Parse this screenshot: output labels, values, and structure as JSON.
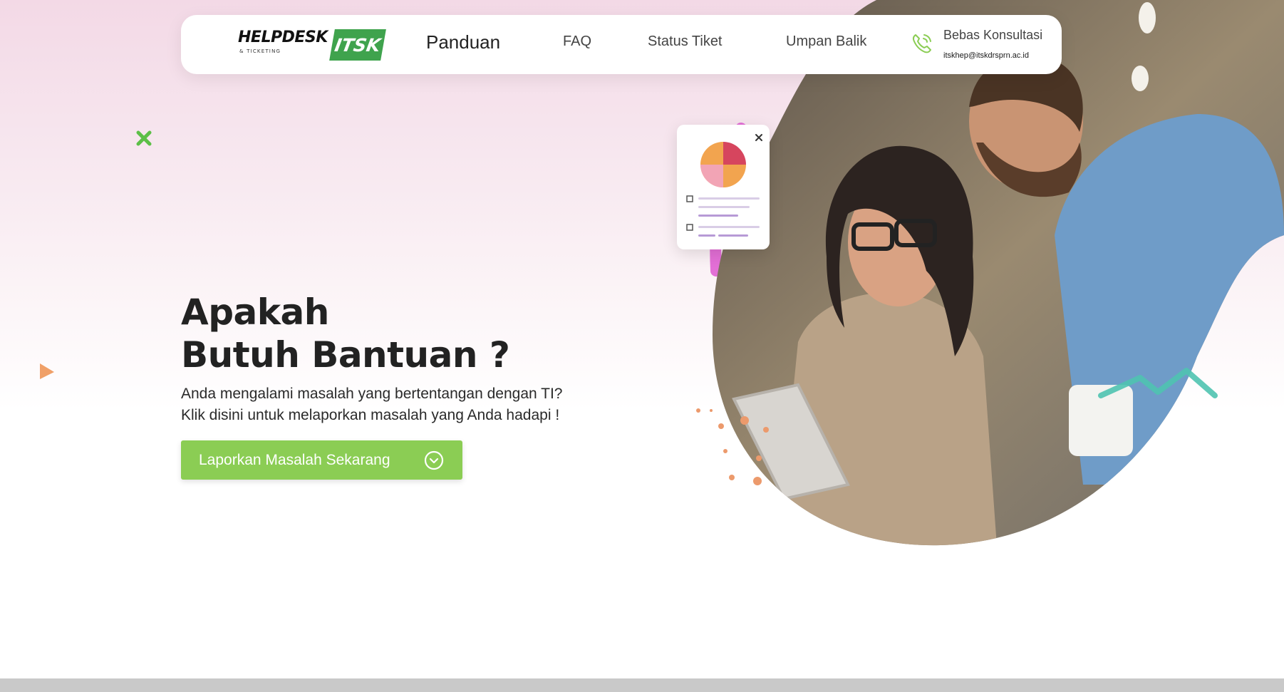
{
  "nav": {
    "logo_main": "HELPDESK",
    "logo_sub": "& TICKETING",
    "logo_badge": "ITSK",
    "links": [
      "Panduan",
      "FAQ",
      "Status Tiket",
      "Umpan Balik"
    ],
    "contact_title": "Bebas Konsultasi",
    "contact_email": "itskhep@itskdrsprn.ac.id",
    "contact_icon": "phone-icon"
  },
  "hero": {
    "headline_line1": "Apakah",
    "headline_line2": "Butuh Bantuan ?",
    "subtext_line1": "Anda mengalami masalah yang bertentangan dengan TI?",
    "subtext_line2": "Klik disini untuk melaporkan masalah yang Anda hadapi !",
    "cta_label": "Laporkan Masalah Sekarang",
    "cta_icon": "chevron-down-circle-icon"
  },
  "colors": {
    "accent_green": "#8bcd54",
    "logo_green": "#3fa34d",
    "bg_pink": "#f3d9e6"
  }
}
